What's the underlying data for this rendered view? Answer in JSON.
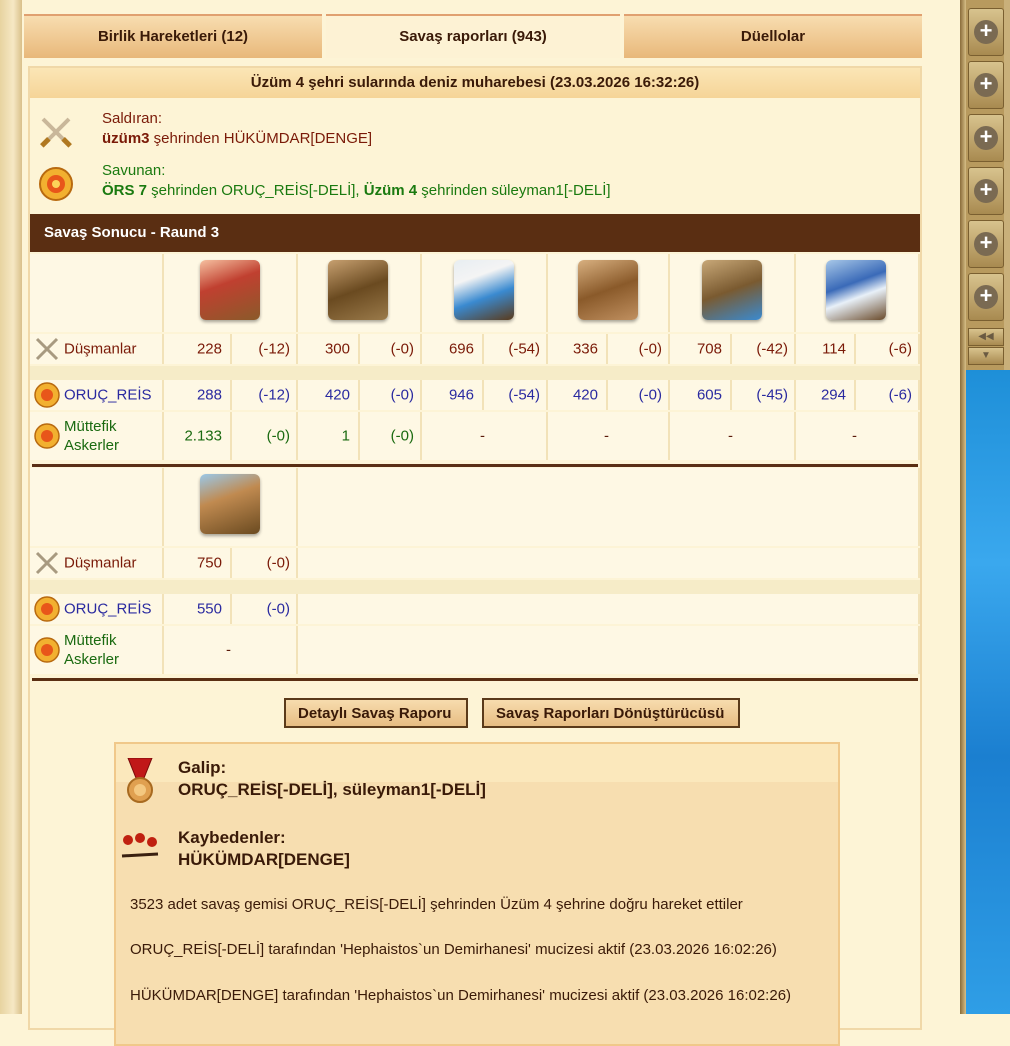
{
  "tabs": [
    {
      "label": "Birlik Hareketleri (12)"
    },
    {
      "label": "Savaş raporları (943)"
    },
    {
      "label": "Düellolar"
    }
  ],
  "report": {
    "title": "Üzüm 4 şehri sularında deniz muharebesi (23.03.2026 16:32:26)",
    "attacker_label": "Saldıran:",
    "attacker_city": "üzüm3",
    "attacker_rest": " şehrinden HÜKÜMDAR[DENGE]",
    "defender_label": "Savunan:",
    "defender_city1": "ÖRS 7",
    "defender_rest1": " şehrinden ORUÇ_REİS[-DELİ], ",
    "defender_city2": "Üzüm 4",
    "defender_rest2": " şehrinden süleyman1[-DELİ]",
    "round_title": "Savaş Sonucu - Raund 3"
  },
  "row_labels": {
    "enemies": "Düşmanlar",
    "oruc": "ORUÇ_REİS",
    "allies": "Müttefik Askerler"
  },
  "units1": [
    {
      "enemy": "228",
      "enemy_loss": "(-12)",
      "oruc": "288",
      "oruc_loss": "(-12)",
      "ally": "2.133",
      "ally_loss": "(-0)"
    },
    {
      "enemy": "300",
      "enemy_loss": "(-0)",
      "oruc": "420",
      "oruc_loss": "(-0)",
      "ally": "1",
      "ally_loss": "(-0)"
    },
    {
      "enemy": "696",
      "enemy_loss": "(-54)",
      "oruc": "946",
      "oruc_loss": "(-54)",
      "ally_dash": "-"
    },
    {
      "enemy": "336",
      "enemy_loss": "(-0)",
      "oruc": "420",
      "oruc_loss": "(-0)",
      "ally_dash": "-"
    },
    {
      "enemy": "708",
      "enemy_loss": "(-42)",
      "oruc": "605",
      "oruc_loss": "(-45)",
      "ally_dash": "-"
    },
    {
      "enemy": "114",
      "enemy_loss": "(-6)",
      "oruc": "294",
      "oruc_loss": "(-6)",
      "ally_dash": "-"
    }
  ],
  "units2": [
    {
      "enemy": "750",
      "enemy_loss": "(-0)",
      "oruc": "550",
      "oruc_loss": "(-0)",
      "ally_dash": "-"
    }
  ],
  "buttons": {
    "detail": "Detaylı Savaş Raporu",
    "converter": "Savaş Raporları Dönüştürücüsü"
  },
  "result": {
    "winner_label": "Galip:",
    "winner_names": "ORUÇ_REİS[-DELİ], süleyman1[-DELİ]",
    "loser_label": "Kaybedenler:",
    "loser_names": "HÜKÜMDAR[DENGE]",
    "line1": "3523 adet savaş gemisi ORUÇ_REİS[-DELİ] şehrinden Üzüm 4 şehrine doğru hareket ettiler",
    "line2": "ORUÇ_REİS[-DELİ] tarafından 'Hephaistos`un Demirhanesi' mucizesi aktif (23.03.2026 16:02:26)",
    "line3": "HÜKÜMDAR[DENGE] tarafından 'Hephaistos`un Demirhanesi' mucizesi aktif (23.03.2026 16:02:26)"
  },
  "colors": {
    "enemy_text": "#7a1a08",
    "oruc_text": "#2a2aa0",
    "ally_text": "#1a6a10",
    "attacker_text": "#7a1a08",
    "defender_text": "#1a7a10"
  },
  "icons": {
    "attacker": "crossed-swords-icon",
    "defender": "sun-shield-icon",
    "winner": "medal-icon",
    "loser": "fallen-soldiers-icon"
  }
}
